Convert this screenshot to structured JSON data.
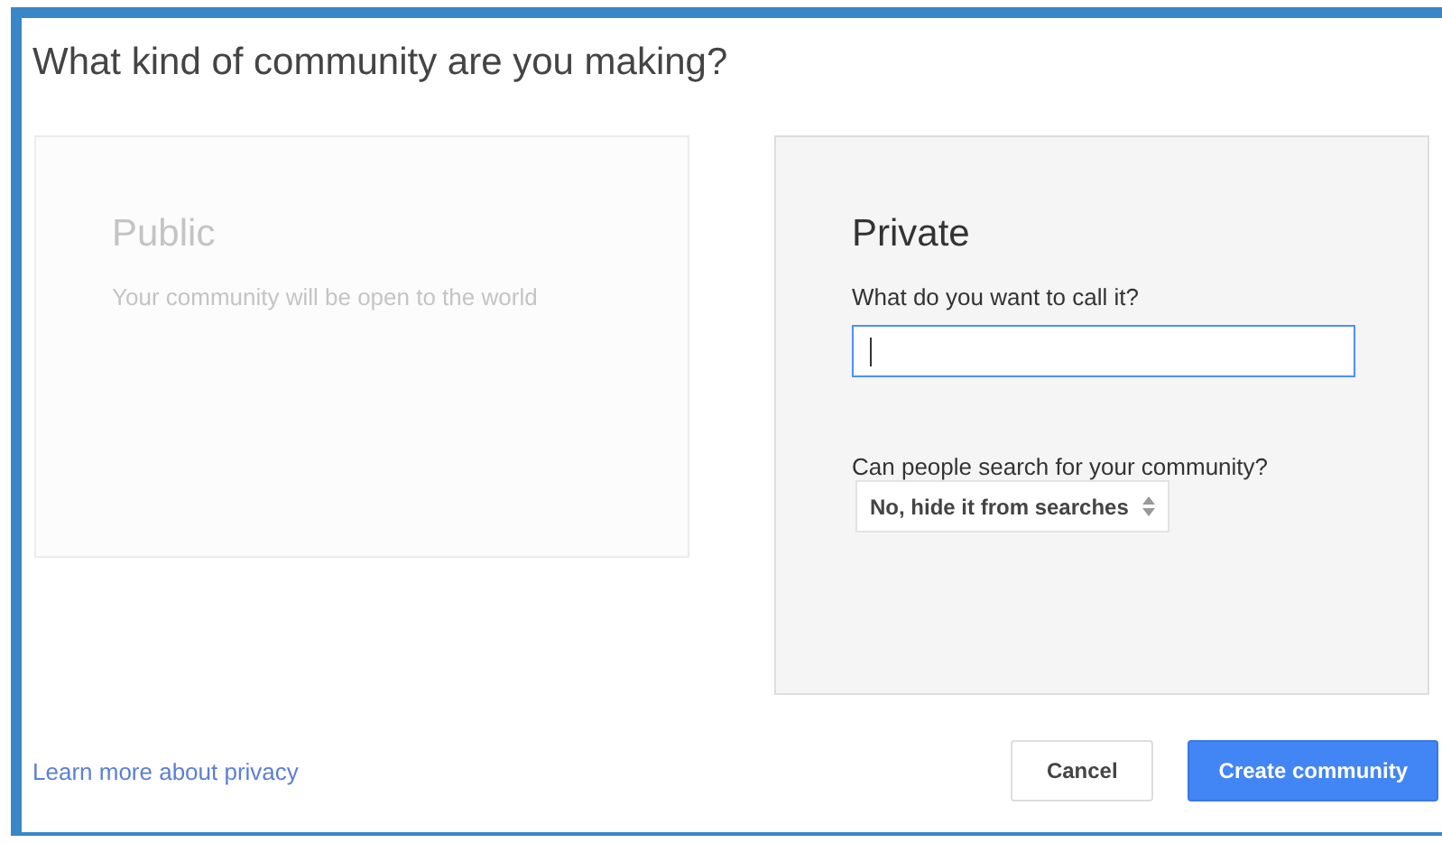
{
  "dialog": {
    "title": "What kind of community are you making?"
  },
  "options": [
    {
      "kind": "public",
      "title": "Public",
      "selected": false,
      "description": "Your community will be open to the world"
    },
    {
      "kind": "private",
      "title": "Private",
      "selected": true,
      "name_label": "What do you want to call it?",
      "search_label": "Can people search for your community?",
      "search_value": "No, hide it from searches"
    }
  ],
  "footer": {
    "link": "Learn more about privacy",
    "buttons": [
      {
        "label": "Cancel",
        "kind": "secondary"
      },
      {
        "label": "Create community",
        "kind": "primary"
      }
    ]
  }
}
